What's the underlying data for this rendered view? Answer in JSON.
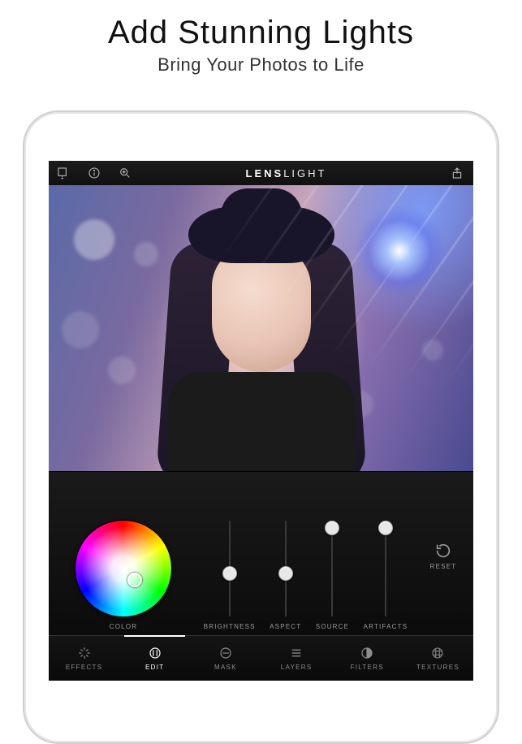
{
  "promo": {
    "title": "Add Stunning Lights",
    "subtitle": "Bring Your Photos to Life"
  },
  "topbar": {
    "title_bold": "LENS",
    "title_light": "LIGHT"
  },
  "panel": {
    "color_label": "COLOR",
    "sliders": {
      "brightness": {
        "label": "BRIGHTNESS",
        "value": 0.45
      },
      "aspect": {
        "label": "ASPECT",
        "value": 0.45
      },
      "source": {
        "label": "SOURCE",
        "value": 0.92
      },
      "artifacts": {
        "label": "ARTIFACTS",
        "value": 0.92
      }
    },
    "reset_label": "RESET"
  },
  "tabs": {
    "effects": {
      "label": "EFFECTS"
    },
    "edit": {
      "label": "EDIT"
    },
    "mask": {
      "label": "MASK"
    },
    "layers": {
      "label": "LAYERS"
    },
    "filters": {
      "label": "FILTERS"
    },
    "textures": {
      "label": "TEXTURES"
    }
  }
}
